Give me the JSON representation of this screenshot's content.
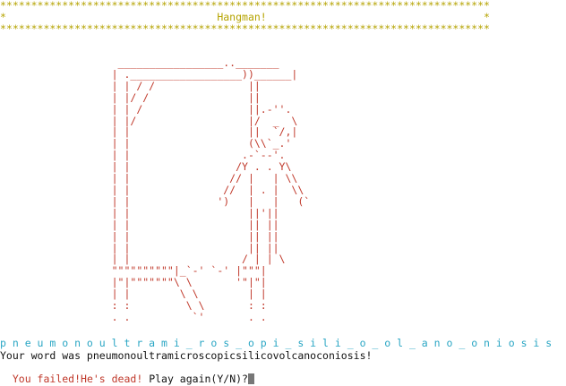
{
  "banner": {
    "top_border": "*******************************************************************************",
    "title_line": "*                                  Hangman!                                   *",
    "bottom_border": "*******************************************************************************"
  },
  "gallows_art": "                   _________________.._______\n                  | .__________________))______|\n                  | | / /               ||\n                  | |/ /                ||\n                  | | /                 ||.-''.\n                  | |/                  |/  _  \\\n                  | |                   ||  `/,|\n                  | |                   (\\\\`_.'\n                  | |                  .-`--'.\n                  | |                 /Y . . Y\\\n                  | |                // |   | \\\\\n                  | |               //  | . |  \\\\\n                  | |              ')   |   |   (`\n                  | |                   ||'||\n                  | |                   || ||\n                  | |                   || ||\n                  | |                   || ||\n                  | |                  / | | \\\n                  \"\"\"\"\"\"\"\"\"\"|_`-' `-' |\"\"\"|\n                  |\"|\"\"\"\"\"\"\"\\ \\       '\"|\"|\n                  | |        \\ \\        | |\n                  : :         \\ \\       : :\n                  . .          `'       . .",
  "game": {
    "revealed_word": "p n e u m o n o u l t r a m i _ r o s _ o p i _ s i l i _ o _ o l _ a n o _ o n i o s i s",
    "answer_message": "Your word was pneumonoultramicroscopicsilicovolcanoconiosis!",
    "fail_message": "You failed!He's dead!",
    "prompt": " Play again(Y/N)?"
  },
  "colors": {
    "banner": "#b5a300",
    "gallows": "#c0392b",
    "word": "#2aa6c4",
    "fail": "#c0392b",
    "text": "#111111"
  }
}
